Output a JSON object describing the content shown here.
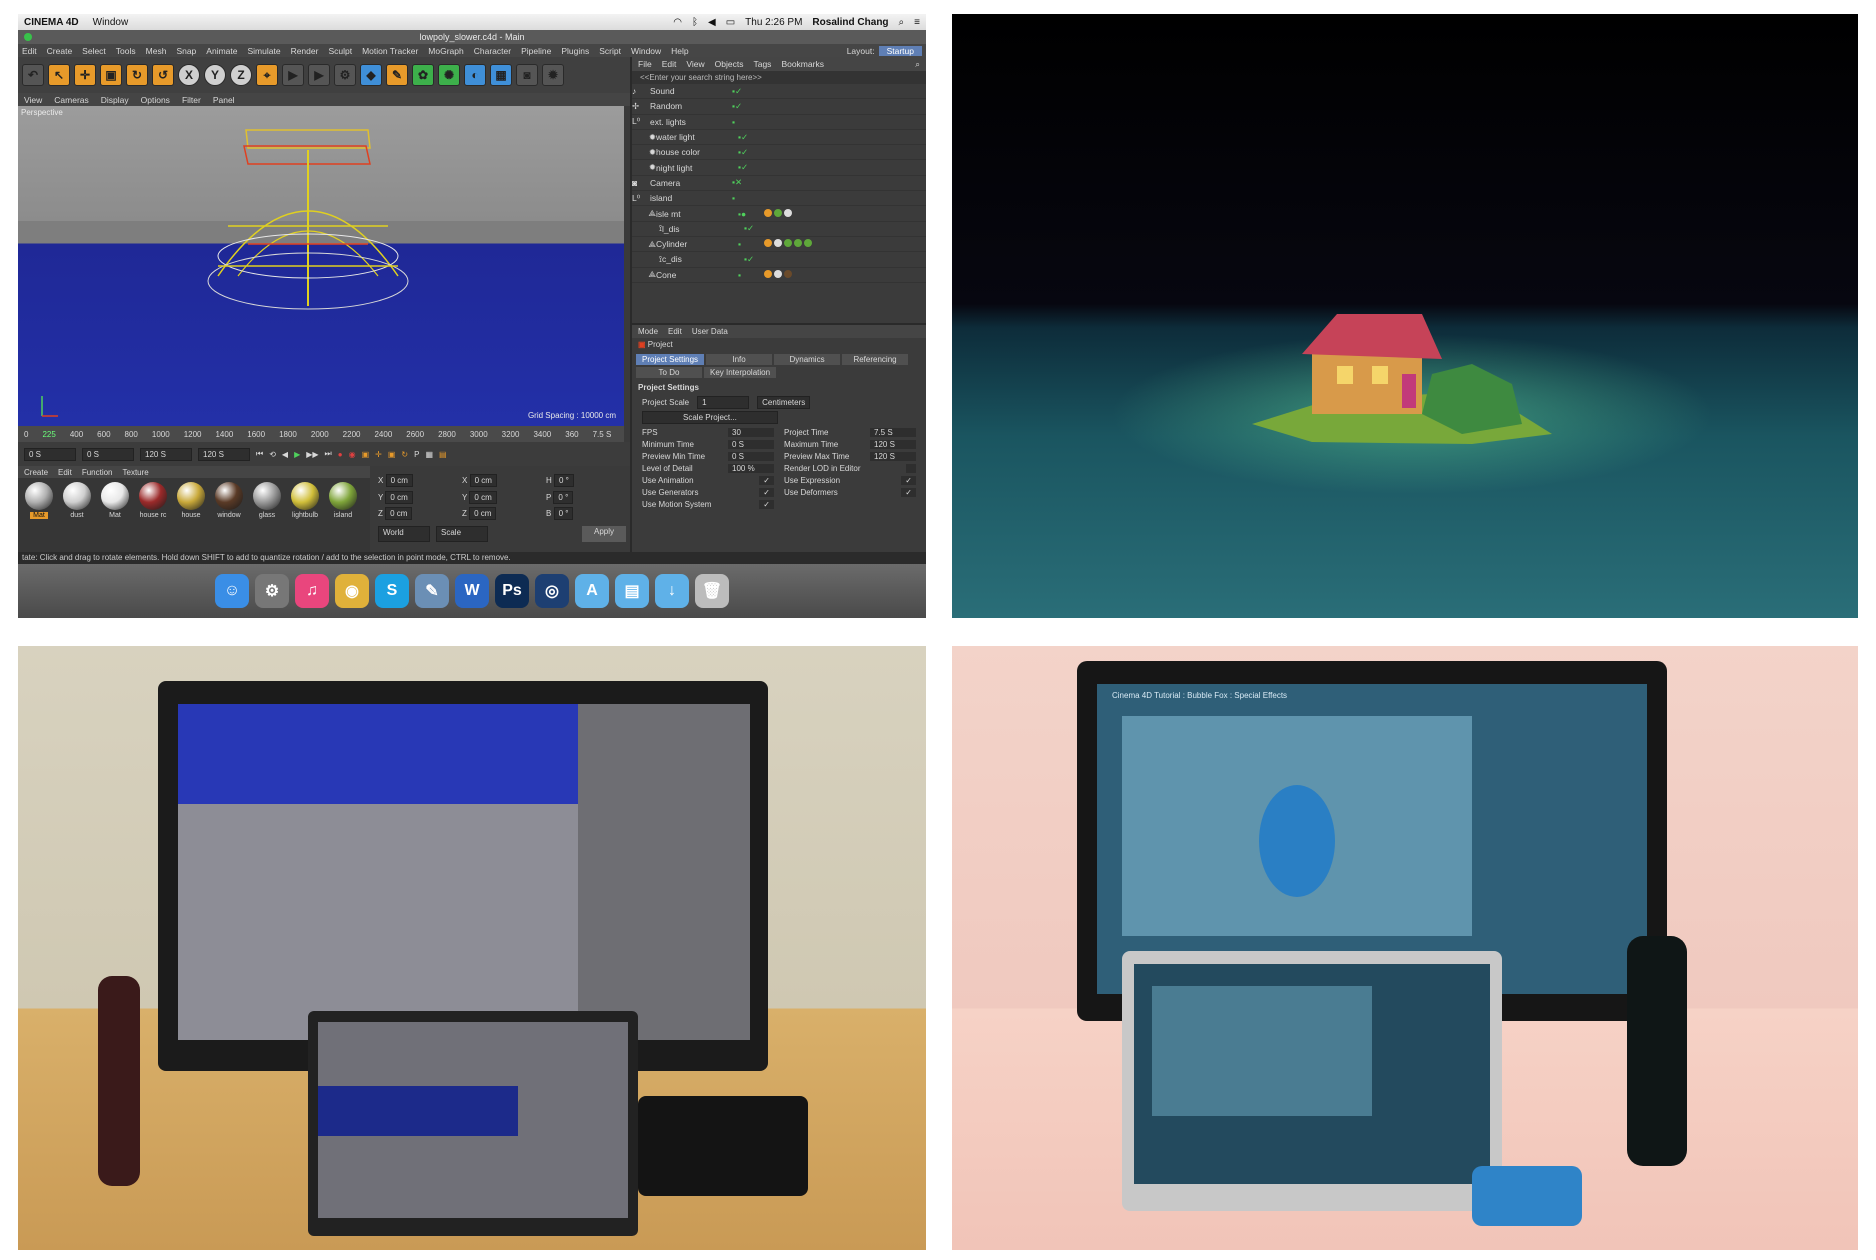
{
  "c4d": {
    "menubar": {
      "app": "CINEMA 4D",
      "window_menu": "Window",
      "datetime": "Thu 2:26 PM",
      "user": "Rosalind Chang"
    },
    "window_title": "lowpoly_slower.c4d - Main",
    "menu": [
      "Edit",
      "Create",
      "Select",
      "Tools",
      "Mesh",
      "Snap",
      "Animate",
      "Simulate",
      "Render",
      "Sculpt",
      "Motion Tracker",
      "MoGraph",
      "Character",
      "Pipeline",
      "Plugins",
      "Script",
      "Window",
      "Help"
    ],
    "layout_label": "Layout:",
    "layout_value": "Startup",
    "view_menu": [
      "View",
      "Cameras",
      "Display",
      "Options",
      "Filter",
      "Panel"
    ],
    "viewport_label": "Perspective",
    "grid_spacing": "Grid Spacing : 10000 cm",
    "timeline_ticks": [
      "0",
      "225",
      "400",
      "600",
      "800",
      "1000",
      "1200",
      "1400",
      "1600",
      "1800",
      "2000",
      "2200",
      "2400",
      "2600",
      "2800",
      "3000",
      "3200",
      "3400",
      "360",
      "7.5 S"
    ],
    "transport": {
      "start": "0 S",
      "current": "0 S",
      "end_a": "120 S",
      "end_b": "120 S"
    },
    "material_menu": [
      "Create",
      "Edit",
      "Function",
      "Texture"
    ],
    "materials": [
      {
        "name": "Mat",
        "color": "#b0b0b0"
      },
      {
        "name": "dust",
        "color": "#cfcfcf"
      },
      {
        "name": "Mat",
        "color": "#e8e8e8"
      },
      {
        "name": "house rc",
        "color": "#9b2a2a"
      },
      {
        "name": "house",
        "color": "#c9a93a"
      },
      {
        "name": "window",
        "color": "#5a3a26"
      },
      {
        "name": "glass",
        "color": "#9a9a9a"
      },
      {
        "name": "lightbulb",
        "color": "#d1bf3a"
      },
      {
        "name": "island",
        "color": "#7fa53a"
      }
    ],
    "coords": {
      "x": "0 cm",
      "y": "0 cm",
      "z": "0 cm",
      "x2": "0 cm",
      "y2": "0 cm",
      "z2": "0 cm",
      "h": "0 °",
      "p": "0 °",
      "b": "0 °",
      "world": "World",
      "scale": "Scale",
      "apply": "Apply"
    },
    "object_menu": [
      "File",
      "Edit",
      "View",
      "Objects",
      "Tags",
      "Bookmarks"
    ],
    "object_search": "<<Enter your search string here>>",
    "objects": [
      "Sound",
      "Random",
      "ext. lights",
      "water light",
      "house color",
      "night light",
      "Camera",
      "island",
      "isle mt",
      "l_dis",
      "Cylinder",
      "c_dis",
      "Cone"
    ],
    "attr_menu": [
      "Mode",
      "Edit",
      "User Data"
    ],
    "attr_object": "Project",
    "attr_tabs": [
      "Project Settings",
      "Info",
      "Dynamics",
      "Referencing",
      "To Do",
      "Key Interpolation"
    ],
    "settings_title": "Project Settings",
    "project_scale_label": "Project Scale",
    "project_scale_value": "1",
    "project_scale_unit": "Centimeters",
    "scale_project_button": "Scale Project...",
    "settings": [
      {
        "label": "FPS",
        "value": "30"
      },
      {
        "label": "Project Time",
        "value": "7.5 S"
      },
      {
        "label": "Minimum Time",
        "value": "0 S"
      },
      {
        "label": "Maximum Time",
        "value": "120 S"
      },
      {
        "label": "Preview Min Time",
        "value": "0 S"
      },
      {
        "label": "Preview Max Time",
        "value": "120 S"
      },
      {
        "label": "Level of Detail",
        "value": "100 %"
      },
      {
        "label": "Render LOD in Editor",
        "value": ""
      },
      {
        "label": "Use Animation",
        "value": "✓"
      },
      {
        "label": "Use Expression",
        "value": "✓"
      },
      {
        "label": "Use Generators",
        "value": "✓"
      },
      {
        "label": "Use Deformers",
        "value": "✓"
      },
      {
        "label": "Use Motion System",
        "value": "✓"
      }
    ],
    "status_text": "tate: Click and drag to rotate elements. Hold down SHIFT to add to quantize rotation / add to the selection in point mode, CTRL to remove.",
    "dock_icons": [
      {
        "icon": "finder-icon",
        "color": "#3a8ee6"
      },
      {
        "icon": "system-preferences-icon",
        "color": "#777777"
      },
      {
        "icon": "itunes-icon",
        "color": "#e9467d"
      },
      {
        "icon": "chrome-icon",
        "color": "#e0b13a"
      },
      {
        "icon": "skype-icon",
        "color": "#1ba0e1"
      },
      {
        "icon": "preview-icon",
        "color": "#6b8fb5"
      },
      {
        "icon": "word-icon",
        "color": "#2b66c2"
      },
      {
        "icon": "photoshop-icon",
        "color": "#0d2b53"
      },
      {
        "icon": "cinema4d-icon",
        "color": "#1d3f72"
      },
      {
        "icon": "applications-folder-icon",
        "color": "#5fb1e8"
      },
      {
        "icon": "documents-folder-icon",
        "color": "#5fb1e8"
      },
      {
        "icon": "downloads-folder-icon",
        "color": "#5fb1e8"
      },
      {
        "icon": "trash-icon",
        "color": "#bcbcbc"
      }
    ],
    "dock_glyphs": [
      "☺",
      "⚙",
      "♫",
      "◉",
      "S",
      "✎",
      "W",
      "Ps",
      "◎",
      "A",
      "▤",
      "↓",
      "🗑"
    ]
  },
  "photo2_screen_title": "Cinema 4D Tutorial : Bubble Fox : Special Effects"
}
